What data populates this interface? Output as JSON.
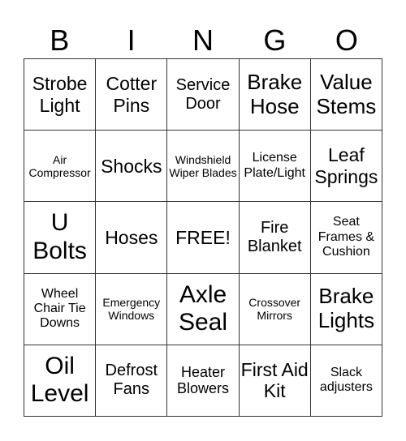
{
  "header": [
    "B",
    "I",
    "N",
    "G",
    "O"
  ],
  "cells": [
    {
      "text": "Strobe Light",
      "size": "s23"
    },
    {
      "text": "Cotter Pins",
      "size": "s23"
    },
    {
      "text": "Service Door",
      "size": "s20"
    },
    {
      "text": "Brake Hose",
      "size": "s26"
    },
    {
      "text": "Value Stems",
      "size": "s26"
    },
    {
      "text": "Air Compressor",
      "size": "s14"
    },
    {
      "text": "Shocks",
      "size": "s23"
    },
    {
      "text": "Windshield Wiper Blades",
      "size": "s14"
    },
    {
      "text": "License Plate/Light",
      "size": "s16"
    },
    {
      "text": "Leaf Springs",
      "size": "s23"
    },
    {
      "text": "U Bolts",
      "size": "s30"
    },
    {
      "text": "Hoses",
      "size": "s23"
    },
    {
      "text": "FREE!",
      "size": "s23"
    },
    {
      "text": "Fire Blanket",
      "size": "s20"
    },
    {
      "text": "Seat Frames & Cushion",
      "size": "s16"
    },
    {
      "text": "Wheel Chair Tie Downs",
      "size": "s16"
    },
    {
      "text": "Emergency Windows",
      "size": "s14"
    },
    {
      "text": "Axle Seal",
      "size": "s30"
    },
    {
      "text": "Crossover Mirrors",
      "size": "s14"
    },
    {
      "text": "Brake Lights",
      "size": "s26"
    },
    {
      "text": "Oil Level",
      "size": "s30"
    },
    {
      "text": "Defrost Fans",
      "size": "s20"
    },
    {
      "text": "Heater Blowers",
      "size": "s18"
    },
    {
      "text": "First Aid Kit",
      "size": "s23"
    },
    {
      "text": "Slack adjusters",
      "size": "s16"
    }
  ]
}
